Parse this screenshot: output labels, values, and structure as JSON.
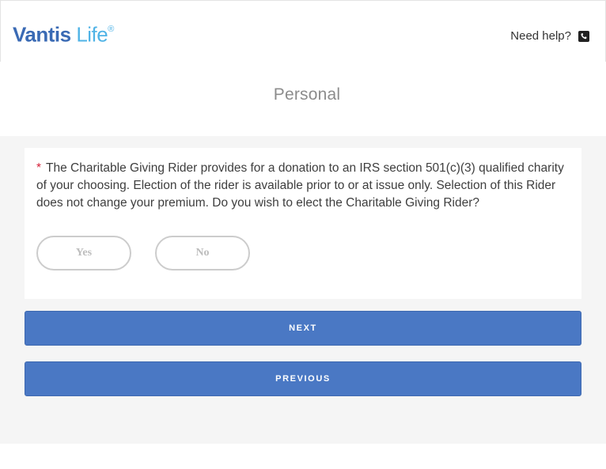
{
  "header": {
    "logo_part1": "Vantis",
    "logo_part2": " Life",
    "logo_mark": "®",
    "help_label": "Need help?",
    "help_icon": "phone-icon"
  },
  "section": {
    "title": "Personal"
  },
  "question": {
    "required_marker": "*",
    "text": "The Charitable Giving Rider provides for a donation to an IRS section 501(c)(3) qualified charity of your choosing. Election of the rider is available prior to or at issue only. Selection of this Rider does not change your premium. Do you wish to elect the Charitable Giving Rider?",
    "options": [
      "Yes",
      "No"
    ]
  },
  "actions": {
    "next_label": "NEXT",
    "previous_label": "PREVIOUS"
  },
  "colors": {
    "brand_dark": "#3a6ab4",
    "brand_light": "#4fb3e6",
    "button": "#4a78c4",
    "required": "#d6223a"
  }
}
